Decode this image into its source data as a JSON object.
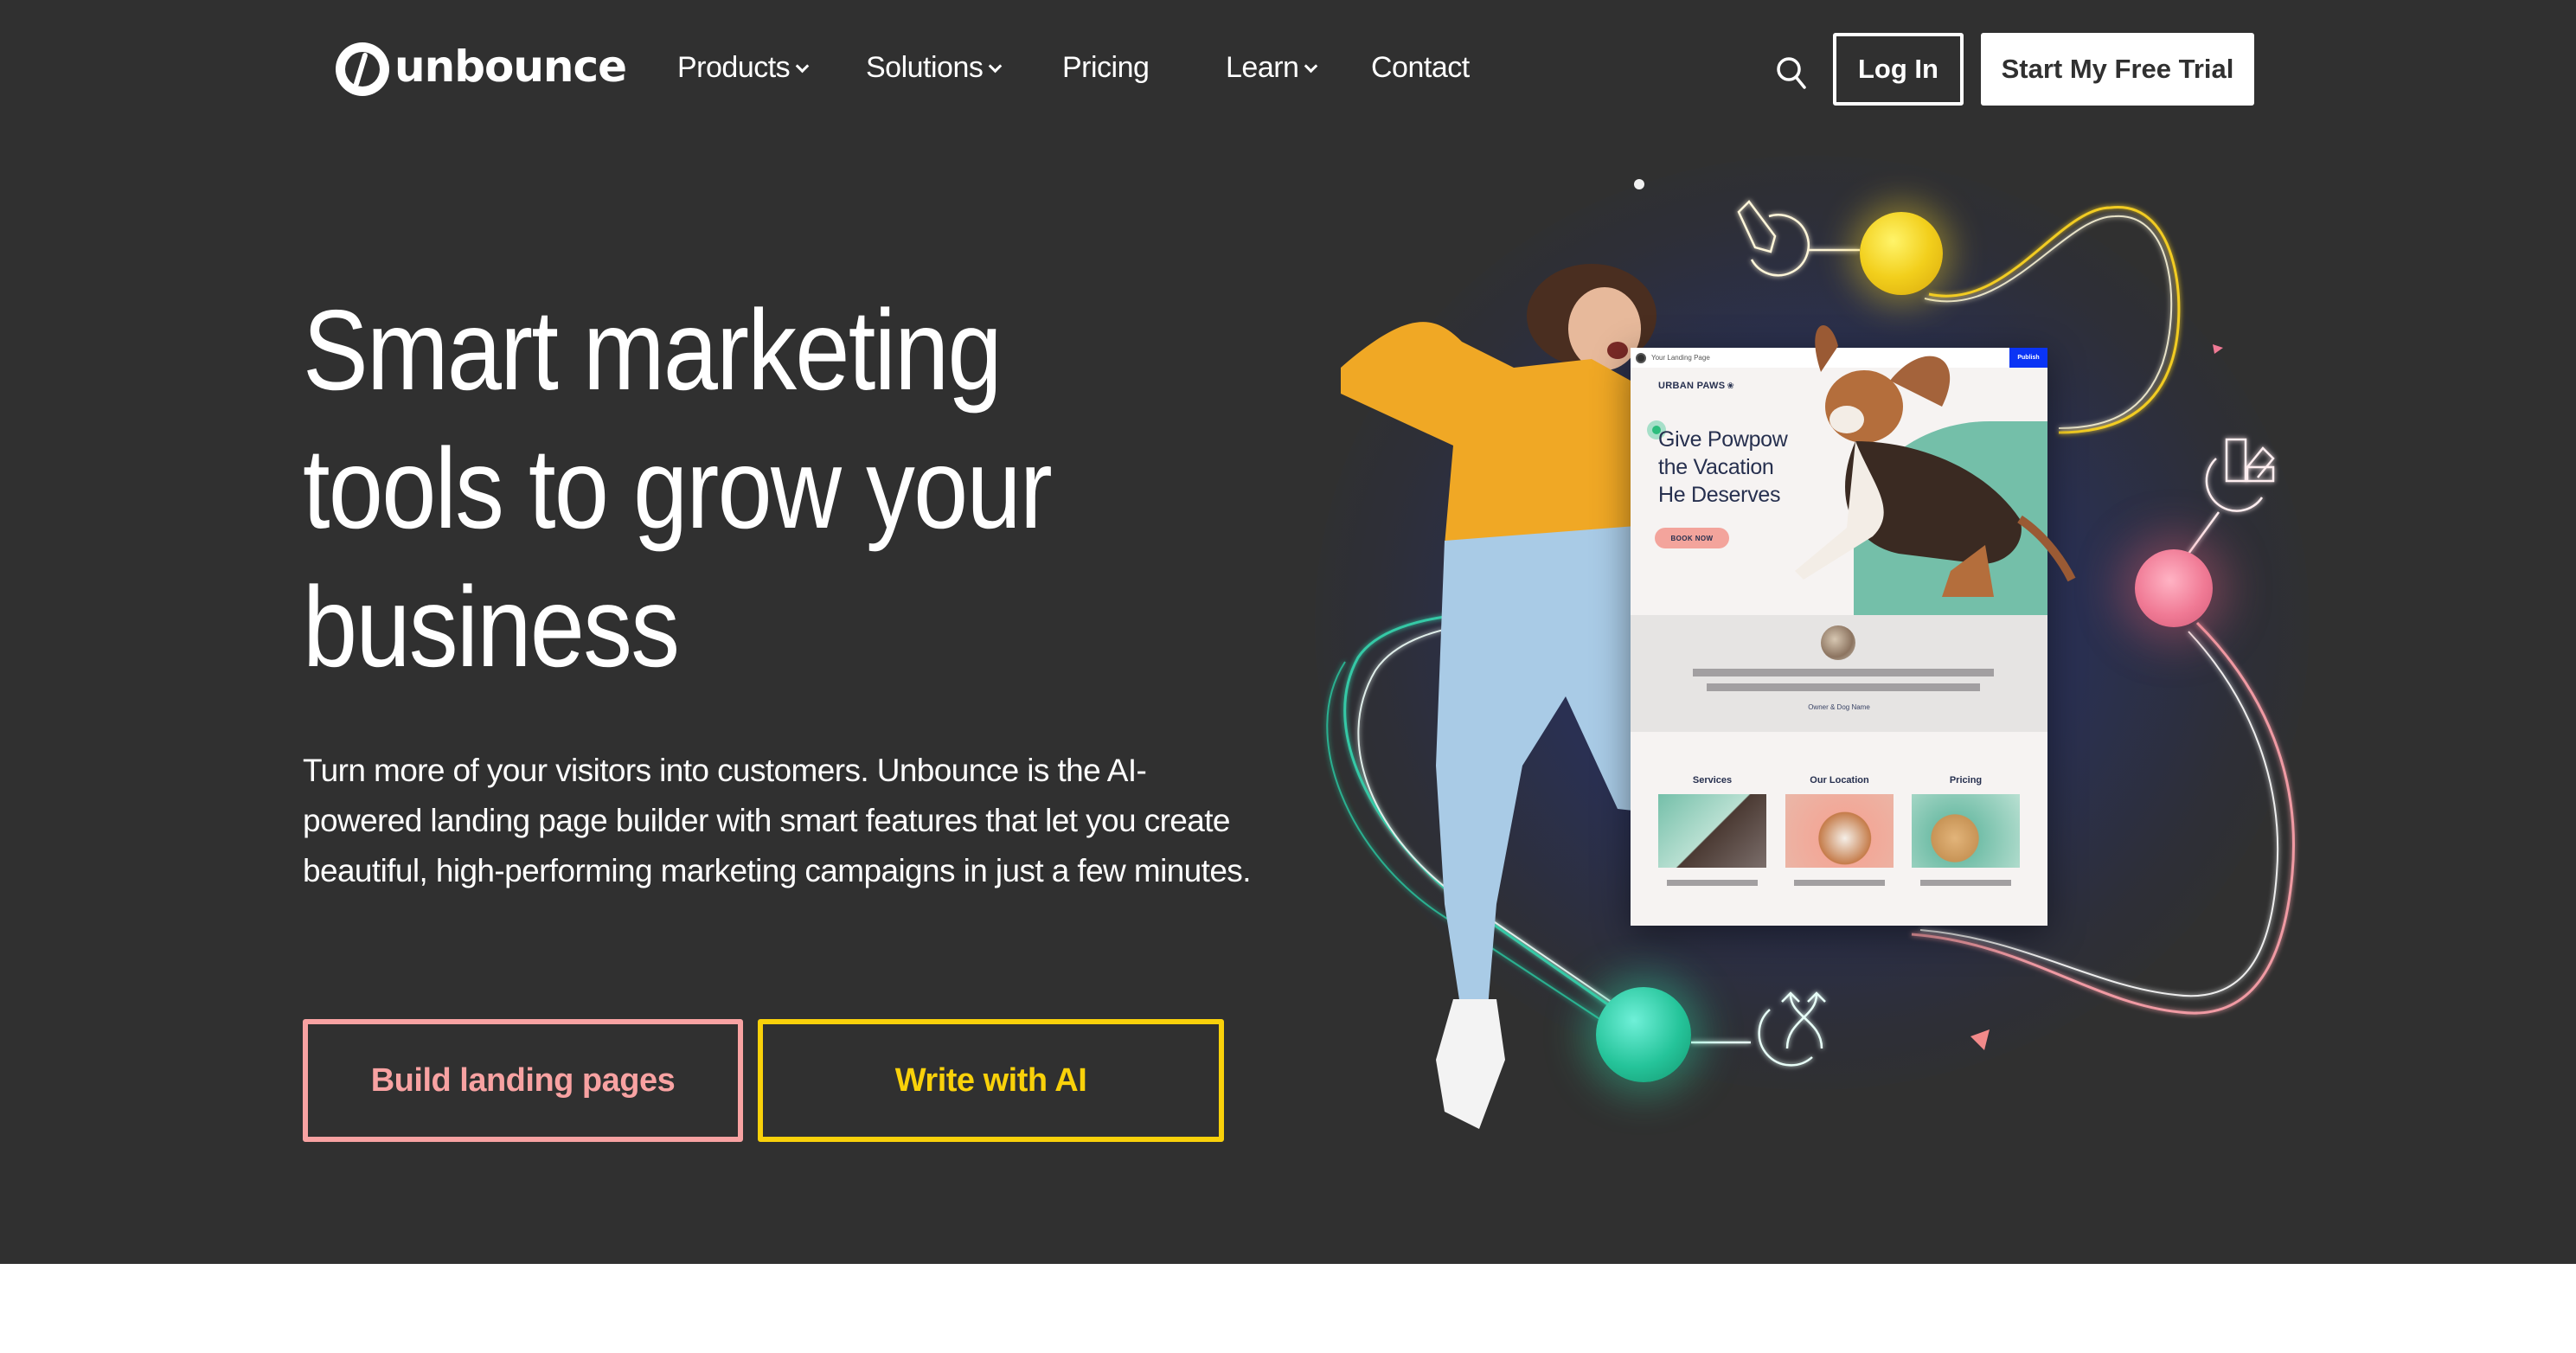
{
  "brand": {
    "name": "unbounce",
    "logo_icon": "unbounce-logo-icon"
  },
  "nav": {
    "items": [
      {
        "label": "Products",
        "has_dropdown": true
      },
      {
        "label": "Solutions",
        "has_dropdown": true
      },
      {
        "label": "Pricing",
        "has_dropdown": false
      },
      {
        "label": "Learn",
        "has_dropdown": true
      },
      {
        "label": "Contact",
        "has_dropdown": false
      }
    ],
    "search_icon": "search-icon",
    "login_label": "Log In",
    "trial_label": "Start My Free Trial"
  },
  "hero": {
    "headline_lines": [
      "Smart marketing",
      "tools to grow your",
      "business"
    ],
    "subcopy": "Turn more of your visitors into customers. Unbounce is the AI-powered landing page builder with smart features that let you create beautiful, high-performing marketing campaigns in just a few minutes.",
    "cta_primary": "Build landing pages",
    "cta_secondary": "Write with AI"
  },
  "illustration": {
    "mockup": {
      "page_title": "Your Landing Page",
      "publish_label": "Publish",
      "brand": "URBAN PAWS",
      "brand_icon": "paw-icon",
      "headline_lines": [
        "Give Powpow",
        "the Vacation",
        "He Deserves"
      ],
      "cta": "BOOK NOW",
      "testimonial_name": "Owner & Dog Name",
      "columns": [
        {
          "label": "Services"
        },
        {
          "label": "Our Location"
        },
        {
          "label": "Pricing"
        }
      ]
    },
    "icons": [
      "pen-icon",
      "swatch-icon",
      "split-arrows-icon"
    ]
  },
  "colors": {
    "background": "#303030",
    "cta_primary": "#f8a2a2",
    "cta_secondary": "#f9d10a",
    "publish": "#0a34f5",
    "mock_accent": "#74bfa9"
  }
}
